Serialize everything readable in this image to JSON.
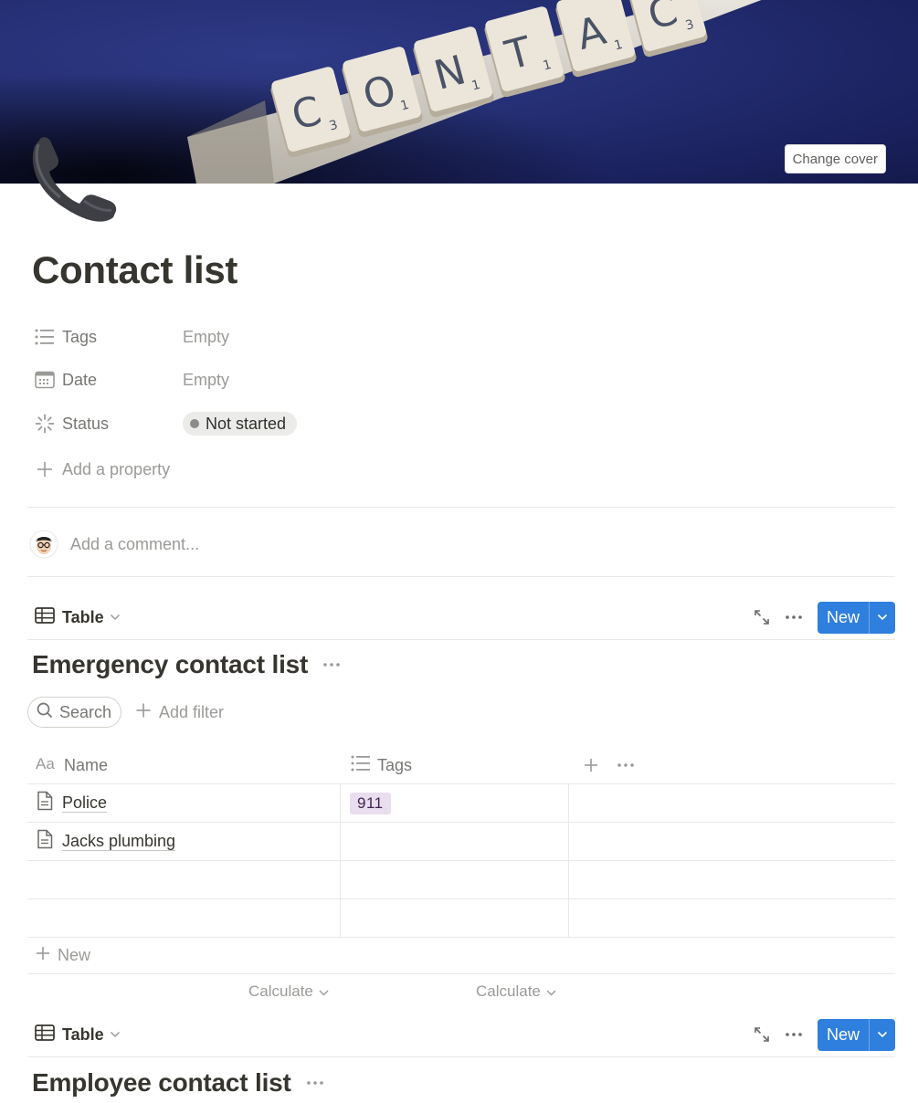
{
  "cover": {
    "change_cover_label": "Change cover",
    "tile_letters": [
      "C",
      "O",
      "N",
      "T",
      "A",
      "C"
    ],
    "tile_subscripts": [
      "3",
      "1",
      "1",
      "1",
      "1",
      "3"
    ]
  },
  "page": {
    "icon": "telephone-receiver-icon",
    "title": "Contact list"
  },
  "properties": [
    {
      "name": "Tags",
      "icon": "list-icon",
      "value": "Empty"
    },
    {
      "name": "Date",
      "icon": "calendar-icon",
      "value": "Empty"
    },
    {
      "name": "Status",
      "icon": "status-spinner-icon",
      "value": "Not started"
    }
  ],
  "add_property_label": "Add a property",
  "comment": {
    "placeholder": "Add a comment..."
  },
  "views": [
    {
      "tab_label": "Table",
      "new_label": "New",
      "title": "Emergency contact list",
      "search_label": "Search",
      "add_filter_label": "Add filter",
      "columns": [
        {
          "label": "Name",
          "icon": "text-aa-icon"
        },
        {
          "label": "Tags",
          "icon": "list-icon"
        }
      ],
      "rows": [
        {
          "name": "Police",
          "tags": [
            "911"
          ]
        },
        {
          "name": "Jacks plumbing",
          "tags": []
        },
        {
          "name": "",
          "tags": []
        },
        {
          "name": "",
          "tags": []
        }
      ],
      "new_row_label": "New",
      "calculate_labels": [
        "Calculate",
        "Calculate"
      ]
    },
    {
      "tab_label": "Table",
      "new_label": "New",
      "title": "Employee contact list"
    }
  ],
  "colors": {
    "accent": "#2f7fde",
    "tag_911_bg": "#e8deee",
    "cover_bg": "#252f74"
  }
}
